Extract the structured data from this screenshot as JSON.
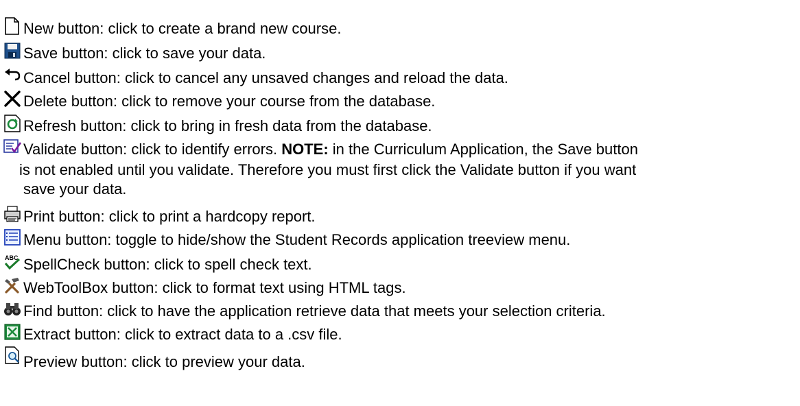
{
  "items": [
    {
      "icon": "new-document-icon",
      "text": "New button: click to create a brand new course."
    },
    {
      "icon": "save-disk-icon",
      "text": "Save button: click to save your data."
    },
    {
      "icon": "undo-arrow-icon",
      "text": "Cancel button: click to cancel any unsaved changes and reload the data."
    },
    {
      "icon": "delete-x-icon",
      "text": "Delete button: click to remove your course from the database."
    },
    {
      "icon": "refresh-icon",
      "text": "Refresh button: click to bring in fresh data from the database."
    },
    {
      "icon": "validate-icon",
      "text": "Validate button: click to identify errors.  ",
      "note_label": "NOTE:",
      "note_text": " in the Curriculum Application, the Save button",
      "cont1": "is not enabled until you validate.  Therefore you must first click the Validate button if you want",
      "cont2": "save your data."
    },
    {
      "icon": "printer-icon",
      "text": "Print button: click to print a hardcopy report."
    },
    {
      "icon": "menu-list-icon",
      "text": "Menu button: toggle to hide/show the Student Records application treeview menu."
    },
    {
      "icon": "spellcheck-icon",
      "text": "SpellCheck button: click to spell check text."
    },
    {
      "icon": "tools-icon",
      "text": "WebToolBox button: click to format text using HTML tags."
    },
    {
      "icon": "binoculars-icon",
      "text": "Find button: click to have the application retrieve data that meets your selection criteria."
    },
    {
      "icon": "excel-extract-icon",
      "text": "Extract button: click to extract data to a .csv file."
    },
    {
      "icon": "preview-icon",
      "text": "Preview button: click to preview your data."
    }
  ]
}
